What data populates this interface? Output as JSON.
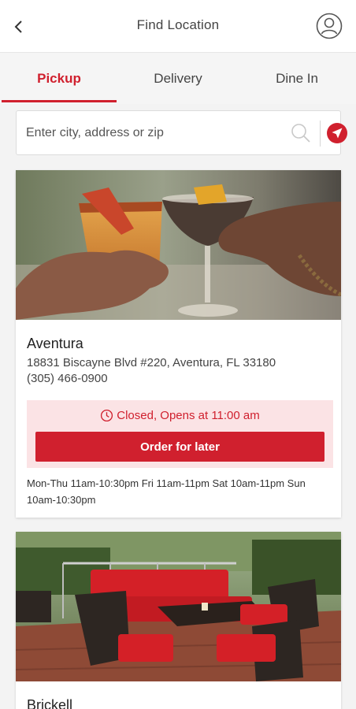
{
  "header": {
    "title": "Find Location",
    "back_icon": "chevron-left-icon",
    "profile_icon": "user-circle-icon"
  },
  "tabs": [
    {
      "label": "Pickup",
      "active": true
    },
    {
      "label": "Delivery",
      "active": false
    },
    {
      "label": "Dine In",
      "active": false
    }
  ],
  "search": {
    "placeholder": "Enter city, address or zip",
    "value": "",
    "search_icon": "search-icon",
    "locate_icon": "locate-arrow-icon"
  },
  "locations": [
    {
      "name": "Aventura",
      "address": "18831 Biscayne Blvd #220, Aventura, FL 33180",
      "phone": "(305) 466-0900",
      "status": "Closed, Opens at 11:00 am",
      "order_label": "Order for later",
      "hours": "Mon-Thu 11am-10:30pm Fri 11am-11pm Sat 10am-11pm Sun 10am-10:30pm",
      "photo": "cocktail-toast-photo"
    },
    {
      "name": "Brickell",
      "photo": "patio-lounge-photo"
    }
  ],
  "colors": {
    "accent": "#d0202e",
    "status_bg": "#fbe3e5",
    "page_bg": "#f3f3f3"
  }
}
